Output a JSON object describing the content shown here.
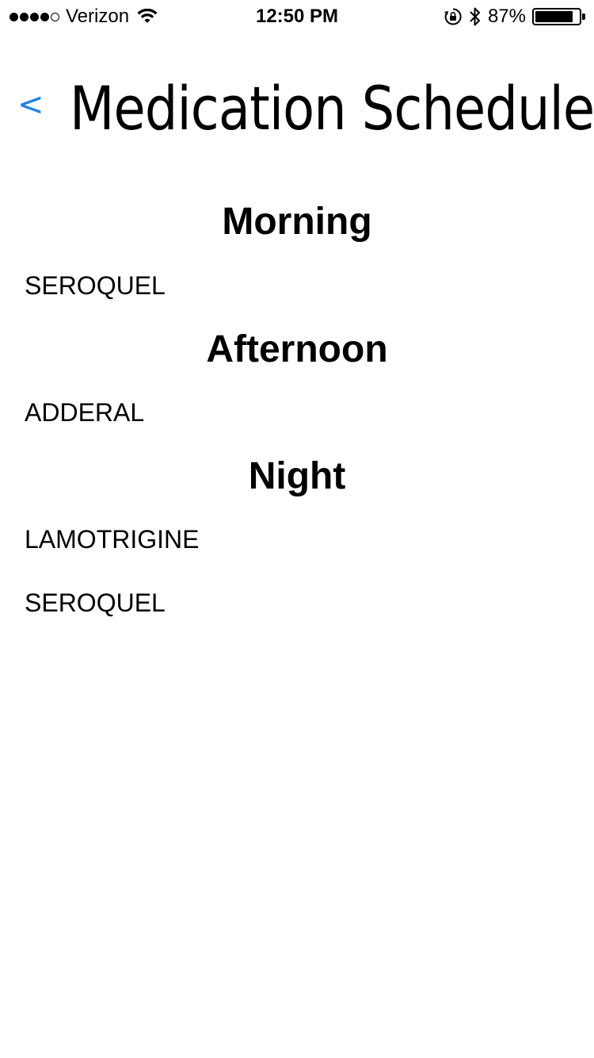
{
  "status_bar": {
    "carrier": "Verizon",
    "signal_bars_filled": 4,
    "signal_bars_total": 5,
    "time": "12:50 PM",
    "battery_percent": "87%",
    "battery_level": 0.87,
    "icons": [
      "signal-icon",
      "wifi-icon",
      "rotation-lock-icon",
      "bluetooth-icon",
      "battery-icon"
    ]
  },
  "header": {
    "back_label": "<",
    "title": "Medication Schedule"
  },
  "colors": {
    "accent": "#1a82e2",
    "text": "#000000",
    "background": "#ffffff"
  },
  "schedule": {
    "morning": {
      "heading": "Morning",
      "meds": [
        "SEROQUEL"
      ]
    },
    "afternoon": {
      "heading": "Afternoon",
      "meds": [
        "ADDERAL"
      ]
    },
    "night": {
      "heading": "Night",
      "meds": [
        "LAMOTRIGINE",
        "SEROQUEL"
      ]
    }
  }
}
